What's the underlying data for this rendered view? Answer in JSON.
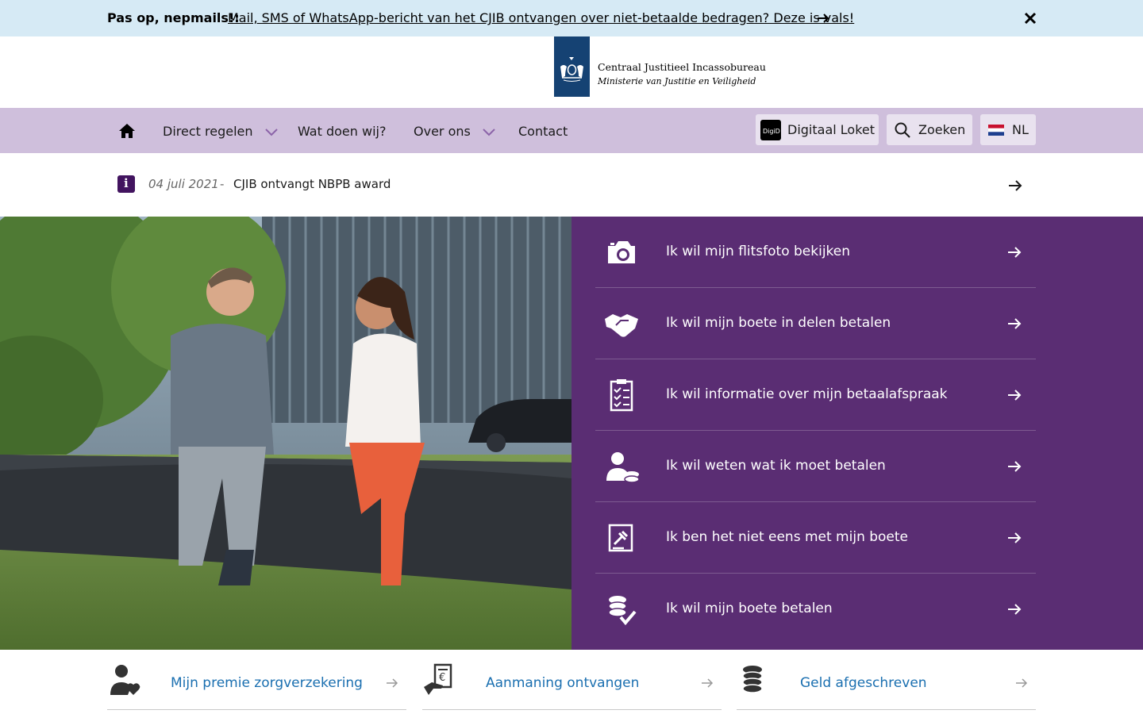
{
  "alert": {
    "title": "Pas op, nepmails!:",
    "link_text": "Mail, SMS of WhatsApp-bericht van het CJIB ontvangen over niet-betaalde bedragen? Deze is vals!",
    "icons": [
      "arrow-right-icon",
      "close-icon"
    ]
  },
  "logo": {
    "line1": "Centraal Justitieel Incassobureau",
    "line2": "Ministerie van Justitie en Veiligheid"
  },
  "nav": {
    "home_icon": "home-icon",
    "items": [
      {
        "label": "Direct regelen",
        "has_dropdown": true
      },
      {
        "label": "Wat doen wij?",
        "has_dropdown": false
      },
      {
        "label": "Over ons",
        "has_dropdown": true
      },
      {
        "label": "Contact",
        "has_dropdown": false
      }
    ],
    "digid_badge": "DigiD",
    "digid_label": "Digitaal Loket",
    "search_label": "Zoeken",
    "language": "NL"
  },
  "news": {
    "date": "04 juli 2021",
    "separator": "-",
    "title": "CJIB ontvangt NBPB award"
  },
  "tasks": [
    {
      "label": "Ik wil mijn flitsfoto bekijken",
      "icon": "camera-icon"
    },
    {
      "label": "Ik wil mijn boete in delen betalen",
      "icon": "handshake-icon"
    },
    {
      "label": "Ik wil informatie over mijn betaalafspraak",
      "icon": "clipboard-checklist-icon"
    },
    {
      "label": "Ik wil weten wat ik moet betalen",
      "icon": "person-coins-icon"
    },
    {
      "label": "Ik ben het niet eens met mijn boete",
      "icon": "gavel-document-icon"
    },
    {
      "label": "Ik wil mijn boete betalen",
      "icon": "coins-check-icon"
    }
  ],
  "quick_links": [
    {
      "label": "Mijn premie zorgverzekering",
      "icon": "person-heart-icon"
    },
    {
      "label": "Aanmaning ontvangen",
      "icon": "hand-euro-document-icon"
    },
    {
      "label": "Geld afgeschreven",
      "icon": "coin-stack-icon"
    }
  ],
  "colors": {
    "alert_bg": "#d6eaf5",
    "nav_bg": "#cfbfdc",
    "task_panel_bg": "#5a2d73",
    "news_icon_bg": "#42145f",
    "link_blue": "#1a6fb0",
    "logo_blue": "#154273"
  }
}
